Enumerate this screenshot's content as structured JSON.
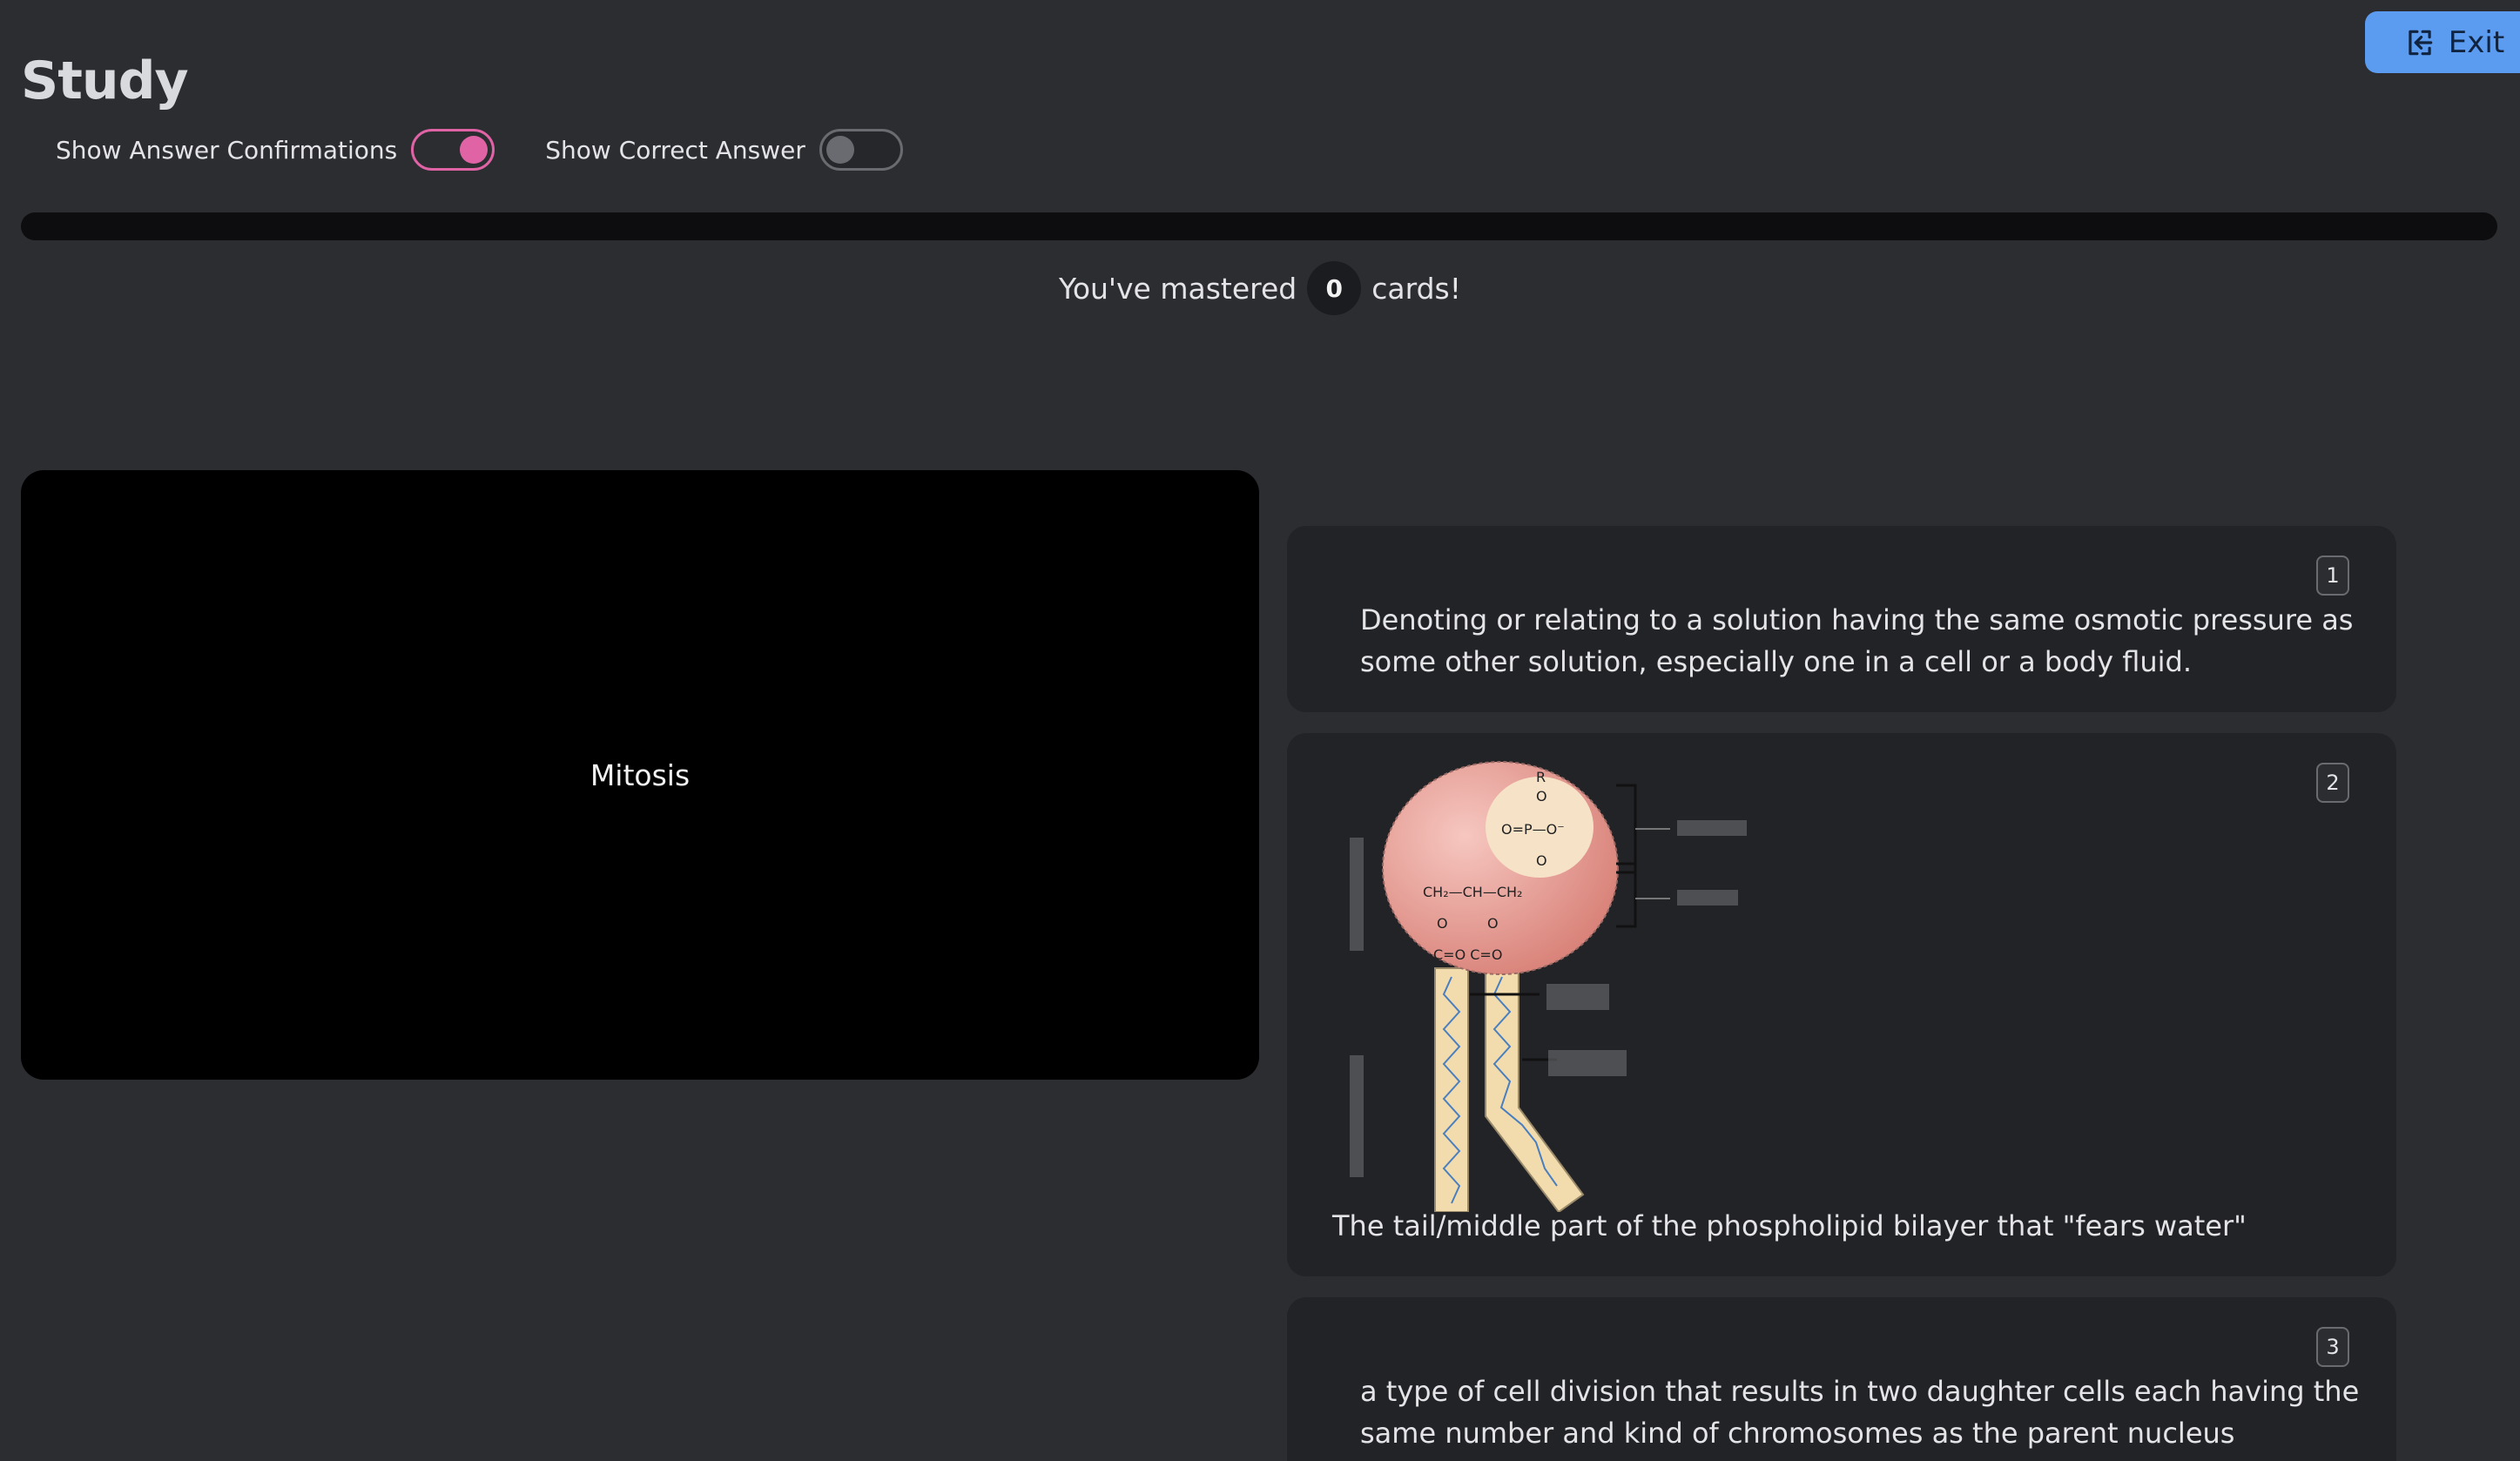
{
  "header": {
    "title": "Study",
    "exit_label": "Exit"
  },
  "settings": {
    "show_confirmations_label": "Show Answer Confirmations",
    "show_confirmations_on": true,
    "show_correct_label": "Show Correct Answer",
    "show_correct_on": false
  },
  "progress": {
    "fraction": 0,
    "mastered_prefix": "You've mastered",
    "mastered_count": "0",
    "mastered_suffix": "cards!"
  },
  "term_card": {
    "term": "Mitosis"
  },
  "answers": [
    {
      "number": "1",
      "text": "Denoting or relating to a solution having the same osmotic pressure as some other solution, especially one in a cell or a body fluid."
    },
    {
      "number": "2",
      "image": "phospholipid-diagram",
      "text": "The tail/middle part of the phospholipid bilayer that \"fears water\""
    },
    {
      "number": "3",
      "text": "a type of cell division that results in two daughter cells each having the same number and kind of chromosomes as the parent nucleus"
    }
  ],
  "colors": {
    "background": "#2c2d31",
    "accent_pink": "#e063a6",
    "exit_blue": "#5b9bf0",
    "card_bg": "#222327"
  }
}
